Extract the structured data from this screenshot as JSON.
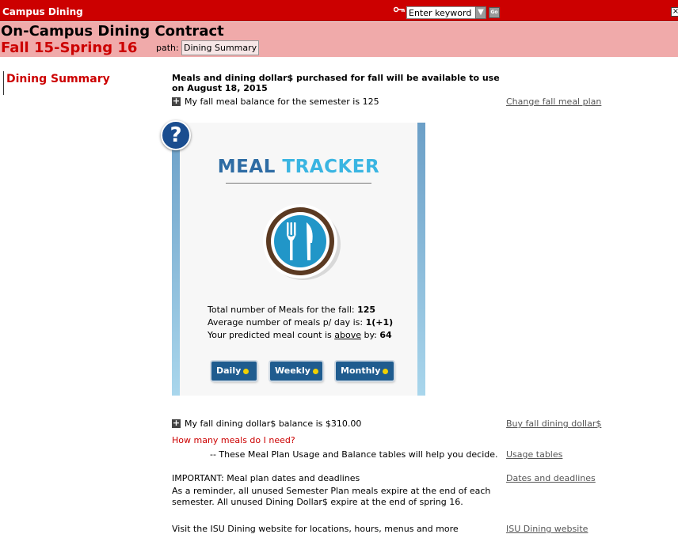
{
  "topbar": {
    "app_title": "Campus Dining",
    "search_value": "Enter keyword",
    "go_label": "Go",
    "close_label": "×"
  },
  "header": {
    "title": "On-Campus Dining Contract",
    "term": "Fall 15-Spring 16",
    "path_label": "path:",
    "breadcrumb": "Dining Summary"
  },
  "sidebar": {
    "active_item": "Dining Summary"
  },
  "main": {
    "intro": "Meals and dining dollar$ purchased for fall will be available to use on August 18, 2015",
    "meal_balance_text": "My fall meal balance for the semester is 125",
    "change_plan_link": "Change fall meal plan",
    "tracker": {
      "help_label": "?",
      "title_part1": "MEAL",
      "title_part2": "TRACKER",
      "total_label": "Total number of Meals for the fall:",
      "total_value": "125",
      "average_label": "Average number of meals p/ day is:",
      "average_value": "1(+1)",
      "predicted_label_pre": "Your predicted meal count is",
      "predicted_link": "above",
      "predicted_label_post": "by:",
      "predicted_value": "64",
      "buttons": [
        "Daily",
        "Weekly",
        "Monthly"
      ]
    },
    "dollar_balance_text": "My fall dining dollar$ balance is $310.00",
    "buy_dollars_link": "Buy fall dining dollar$",
    "how_many_link": "How many meals do I need?",
    "usage_desc": "-- These Meal Plan Usage and Balance tables will help you decide.",
    "usage_link": "Usage tables",
    "important_title": "IMPORTANT: Meal plan dates and deadlines",
    "dates_link": "Dates and deadlines",
    "important_text": "As a reminder, all unused Semester Plan meals expire at the end of each semester. All unused Dining Dollar$ expire at the end of spring 16.",
    "visit_text": "Visit the ISU Dining website for locations, hours, menus and more",
    "isu_link": "ISU Dining website"
  },
  "colors": {
    "brand_red": "#cc0000",
    "header_pink": "#f0aaaa",
    "button_blue": "#1f5c8f",
    "tracker_light_blue": "#3ab5e2"
  }
}
